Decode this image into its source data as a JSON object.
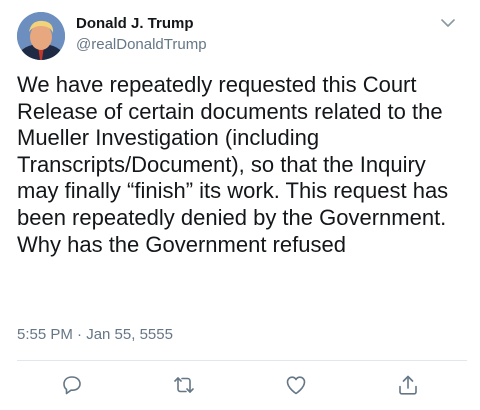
{
  "user": {
    "display_name": "Donald J. Trump",
    "handle": "@realDonaldTrump"
  },
  "tweet": {
    "text": "We have repeatedly requested this Court Release of certain documents related to the Mueller Investigation (including Transcripts/Document), so that the Inquiry may finally “finish” its work. This request has been repeatedly denied by the Government. Why has the Government refused",
    "timestamp": "5:55 PM · Jan 55, 5555"
  },
  "actions": [
    {
      "icon": "reply-icon"
    },
    {
      "icon": "retweet-icon"
    },
    {
      "icon": "like-icon"
    },
    {
      "icon": "share-icon"
    }
  ],
  "colors": {
    "text": "#14171a",
    "secondary": "#657786",
    "divider": "#e1e8ed",
    "icon": "#657786"
  }
}
